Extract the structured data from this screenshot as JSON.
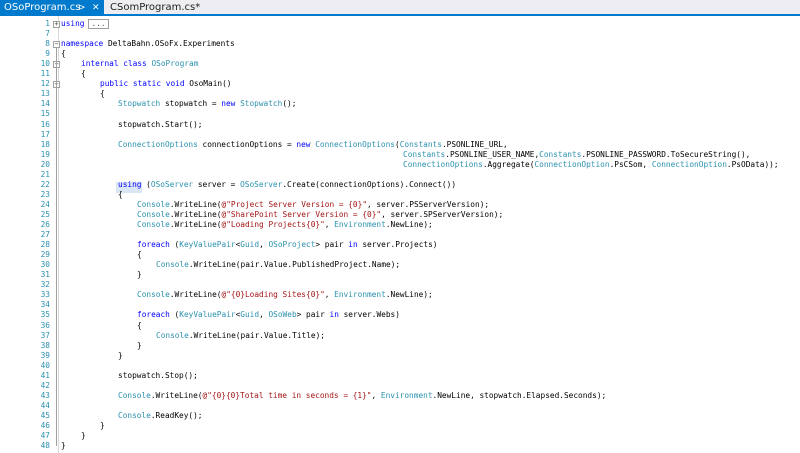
{
  "tabs": [
    {
      "label": "OSoProgram.cs",
      "pin_icon": "pin-icon",
      "close_icon": "close-icon"
    },
    {
      "label": "CSomProgram.cs*"
    }
  ],
  "lines": [
    {
      "n": "1",
      "tokens": [
        {
          "t": "using",
          "c": "kw"
        }
      ]
    },
    {
      "n": "7",
      "tokens": []
    },
    {
      "n": "8",
      "tokens": [
        {
          "t": "namespace",
          "c": "kw"
        },
        {
          "t": " DeltaBahn.OSoFx.Experiments",
          "c": ""
        }
      ]
    },
    {
      "n": "9",
      "tokens": [
        {
          "t": "{",
          "c": ""
        }
      ]
    },
    {
      "n": "10",
      "tokens": [
        {
          "t": "internal",
          "c": "kw"
        },
        {
          "t": " ",
          "c": ""
        },
        {
          "t": "class",
          "c": "kw"
        },
        {
          "t": " ",
          "c": ""
        },
        {
          "t": "OSoProgram",
          "c": "ty"
        }
      ]
    },
    {
      "n": "11",
      "tokens": [
        {
          "t": "{",
          "c": ""
        }
      ]
    },
    {
      "n": "12",
      "tokens": [
        {
          "t": "public",
          "c": "kw"
        },
        {
          "t": " ",
          "c": ""
        },
        {
          "t": "static",
          "c": "kw"
        },
        {
          "t": " ",
          "c": ""
        },
        {
          "t": "void",
          "c": "kw"
        },
        {
          "t": " OsoMain()",
          "c": ""
        }
      ]
    },
    {
      "n": "13",
      "tokens": [
        {
          "t": "{",
          "c": ""
        }
      ]
    },
    {
      "n": "14",
      "tokens": [
        {
          "t": "Stopwatch",
          "c": "ty"
        },
        {
          "t": " stopwatch = ",
          "c": ""
        },
        {
          "t": "new",
          "c": "kw"
        },
        {
          "t": " ",
          "c": ""
        },
        {
          "t": "Stopwatch",
          "c": "ty"
        },
        {
          "t": "();",
          "c": ""
        }
      ]
    },
    {
      "n": "15",
      "tokens": []
    },
    {
      "n": "16",
      "tokens": [
        {
          "t": "stopwatch.Start();",
          "c": ""
        }
      ]
    },
    {
      "n": "17",
      "tokens": []
    },
    {
      "n": "18",
      "tokens": [
        {
          "t": "ConnectionOptions",
          "c": "ty"
        },
        {
          "t": " connectionOptions = ",
          "c": ""
        },
        {
          "t": "new",
          "c": "kw"
        },
        {
          "t": " ",
          "c": ""
        },
        {
          "t": "ConnectionOptions",
          "c": "ty"
        },
        {
          "t": "(",
          "c": ""
        },
        {
          "t": "Constants",
          "c": "ty"
        },
        {
          "t": ".PSONLINE_URL,",
          "c": ""
        }
      ]
    },
    {
      "n": "19",
      "tokens": [
        {
          "t": "Constants",
          "c": "ty"
        },
        {
          "t": ".PSONLINE_USER_NAME,",
          "c": ""
        },
        {
          "t": "Constants",
          "c": "ty"
        },
        {
          "t": ".PSONLINE_PASSWORD.ToSecureString(),",
          "c": ""
        }
      ]
    },
    {
      "n": "20",
      "tokens": [
        {
          "t": "ConnectionOptions",
          "c": "ty"
        },
        {
          "t": ".Aggregate(",
          "c": ""
        },
        {
          "t": "ConnectionOption",
          "c": "ty"
        },
        {
          "t": ".PsCSom, ",
          "c": ""
        },
        {
          "t": "ConnectionOption",
          "c": "ty"
        },
        {
          "t": ".PsOData));",
          "c": ""
        }
      ]
    },
    {
      "n": "21",
      "tokens": []
    },
    {
      "n": "22",
      "tokens": [
        {
          "t": "using",
          "c": "kw"
        },
        {
          "t": " (",
          "c": ""
        },
        {
          "t": "OSoServer",
          "c": "ty"
        },
        {
          "t": " server = ",
          "c": ""
        },
        {
          "t": "OSoServer",
          "c": "ty"
        },
        {
          "t": ".Create(connectionOptions).Connect())",
          "c": ""
        }
      ]
    },
    {
      "n": "23",
      "tokens": [
        {
          "t": "{",
          "c": ""
        }
      ]
    },
    {
      "n": "24",
      "tokens": [
        {
          "t": "Console",
          "c": "ty"
        },
        {
          "t": ".WriteLine(",
          "c": ""
        },
        {
          "t": "@\"Project Server Version = {0}\"",
          "c": "st"
        },
        {
          "t": ", server.PSServerVersion);",
          "c": ""
        }
      ]
    },
    {
      "n": "25",
      "tokens": [
        {
          "t": "Console",
          "c": "ty"
        },
        {
          "t": ".WriteLine(",
          "c": ""
        },
        {
          "t": "@\"SharePoint Server Version = {0}\"",
          "c": "st"
        },
        {
          "t": ", server.SPServerVersion);",
          "c": ""
        }
      ]
    },
    {
      "n": "26",
      "tokens": [
        {
          "t": "Console",
          "c": "ty"
        },
        {
          "t": ".WriteLine(",
          "c": ""
        },
        {
          "t": "@\"Loading Projects{0}\"",
          "c": "st"
        },
        {
          "t": ", ",
          "c": ""
        },
        {
          "t": "Environment",
          "c": "ty"
        },
        {
          "t": ".NewLine);",
          "c": ""
        }
      ]
    },
    {
      "n": "27",
      "tokens": []
    },
    {
      "n": "28",
      "tokens": [
        {
          "t": "foreach",
          "c": "kw"
        },
        {
          "t": " (",
          "c": ""
        },
        {
          "t": "KeyValuePair",
          "c": "ty"
        },
        {
          "t": "<",
          "c": ""
        },
        {
          "t": "Guid",
          "c": "ty"
        },
        {
          "t": ", ",
          "c": ""
        },
        {
          "t": "OSoProject",
          "c": "ty"
        },
        {
          "t": "> pair ",
          "c": ""
        },
        {
          "t": "in",
          "c": "kw"
        },
        {
          "t": " server.Projects)",
          "c": ""
        }
      ]
    },
    {
      "n": "29",
      "tokens": [
        {
          "t": "{",
          "c": ""
        }
      ]
    },
    {
      "n": "30",
      "tokens": [
        {
          "t": "Console",
          "c": "ty"
        },
        {
          "t": ".WriteLine(pair.Value.PublishedProject.Name);",
          "c": ""
        }
      ]
    },
    {
      "n": "31",
      "tokens": [
        {
          "t": "}",
          "c": ""
        }
      ]
    },
    {
      "n": "32",
      "tokens": []
    },
    {
      "n": "33",
      "tokens": [
        {
          "t": "Console",
          "c": "ty"
        },
        {
          "t": ".WriteLine(",
          "c": ""
        },
        {
          "t": "@\"{0}Loading Sites{0}\"",
          "c": "st"
        },
        {
          "t": ", ",
          "c": ""
        },
        {
          "t": "Environment",
          "c": "ty"
        },
        {
          "t": ".NewLine);",
          "c": ""
        }
      ]
    },
    {
      "n": "34",
      "tokens": []
    },
    {
      "n": "35",
      "tokens": [
        {
          "t": "foreach",
          "c": "kw"
        },
        {
          "t": " (",
          "c": ""
        },
        {
          "t": "KeyValuePair",
          "c": "ty"
        },
        {
          "t": "<",
          "c": ""
        },
        {
          "t": "Guid",
          "c": "ty"
        },
        {
          "t": ", ",
          "c": ""
        },
        {
          "t": "OSoWeb",
          "c": "ty"
        },
        {
          "t": "> pair ",
          "c": ""
        },
        {
          "t": "in",
          "c": "kw"
        },
        {
          "t": " server.Webs)",
          "c": ""
        }
      ]
    },
    {
      "n": "36",
      "tokens": [
        {
          "t": "{",
          "c": ""
        }
      ]
    },
    {
      "n": "37",
      "tokens": [
        {
          "t": "Console",
          "c": "ty"
        },
        {
          "t": ".WriteLine(pair.Value.Title);",
          "c": ""
        }
      ]
    },
    {
      "n": "38",
      "tokens": [
        {
          "t": "}",
          "c": ""
        }
      ]
    },
    {
      "n": "39",
      "tokens": [
        {
          "t": "}",
          "c": ""
        }
      ]
    },
    {
      "n": "40",
      "tokens": []
    },
    {
      "n": "41",
      "tokens": [
        {
          "t": "stopwatch.Stop();",
          "c": ""
        }
      ]
    },
    {
      "n": "42",
      "tokens": []
    },
    {
      "n": "43",
      "tokens": [
        {
          "t": "Console",
          "c": "ty"
        },
        {
          "t": ".WriteLine(",
          "c": ""
        },
        {
          "t": "@\"{0}{0}Total time in seconds = {1}\"",
          "c": "st"
        },
        {
          "t": ", ",
          "c": ""
        },
        {
          "t": "Environment",
          "c": "ty"
        },
        {
          "t": ".NewLine, stopwatch.Elapsed.Seconds);",
          "c": ""
        }
      ]
    },
    {
      "n": "44",
      "tokens": []
    },
    {
      "n": "45",
      "tokens": [
        {
          "t": "Console",
          "c": "ty"
        },
        {
          "t": ".ReadKey();",
          "c": ""
        }
      ]
    },
    {
      "n": "46",
      "tokens": [
        {
          "t": "}",
          "c": ""
        }
      ]
    },
    {
      "n": "47",
      "tokens": [
        {
          "t": "}",
          "c": ""
        }
      ]
    },
    {
      "n": "48",
      "tokens": [
        {
          "t": "}",
          "c": ""
        }
      ]
    }
  ],
  "collapsed_marker": "...",
  "fold_expand_symbol": "+",
  "fold_collapse_symbol": "−",
  "colors": {
    "keyword": "#0000ff",
    "type": "#2b91af",
    "string": "#a31515",
    "line_number": "#2b91af",
    "accent": "#007acc"
  }
}
